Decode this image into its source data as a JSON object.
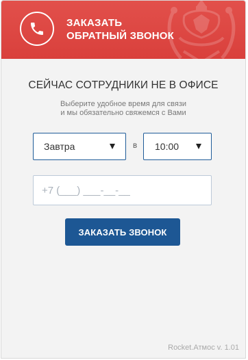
{
  "header": {
    "title_line1": "ЗАКАЗАТЬ",
    "title_line2": "ОБРАТНЫЙ ЗВОНОК",
    "icon": "phone-icon",
    "emblem": "coat-of-arms-emblem"
  },
  "status": {
    "title": "СЕЙЧАС СОТРУДНИКИ НЕ В ОФИСЕ",
    "subtitle_line1": "Выберите удобное время для связи",
    "subtitle_line2": "и мы обязательно свяжемся с Вами"
  },
  "form": {
    "day_value": "Завтра",
    "separator": "в",
    "time_value": "10:00",
    "phone_placeholder": "+7 (___) ___-__-__",
    "phone_value": "",
    "submit_label": "ЗАКАЗАТЬ ЗВОНОК"
  },
  "footer": {
    "version": "Rocket.Атмос v. 1.01"
  },
  "colors": {
    "header_red": "#dd4743",
    "button_blue": "#1d5794",
    "select_border": "#1e5b98"
  }
}
